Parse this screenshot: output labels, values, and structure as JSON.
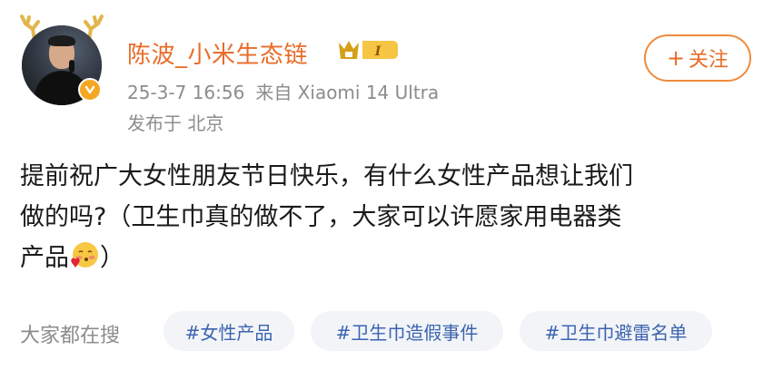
{
  "post": {
    "author": {
      "name": "陈波_小米生态链",
      "avatar_icon": "person-avatar",
      "verified_icon": "verified-badge-icon",
      "level_badge": "I",
      "decoration_icon": "deer-antler-icon"
    },
    "meta": {
      "time": "25-3-7 16:56",
      "source": "来自 Xiaomi 14 Ultra",
      "location": "发布于 北京"
    },
    "follow_label": "关注",
    "follow_icon": "plus-icon",
    "content": {
      "line1": "提前祝广大女性朋友节日快乐，有什么女性产品想让我们",
      "line2": "做的吗?（卫生巾真的做不了，大家可以许愿家用电器类",
      "line3_before": "产品",
      "emoji": "blush-heart-emoji",
      "line3_after": "）"
    }
  },
  "trending": {
    "label": "大家都在搜",
    "tags": [
      "#女性产品",
      "#卫生巾造假事件",
      "#卫生巾避雷名单"
    ]
  },
  "colors": {
    "accent": "#e86c28",
    "tag_text": "#3c63b0",
    "meta_text": "#8c8c8c"
  }
}
